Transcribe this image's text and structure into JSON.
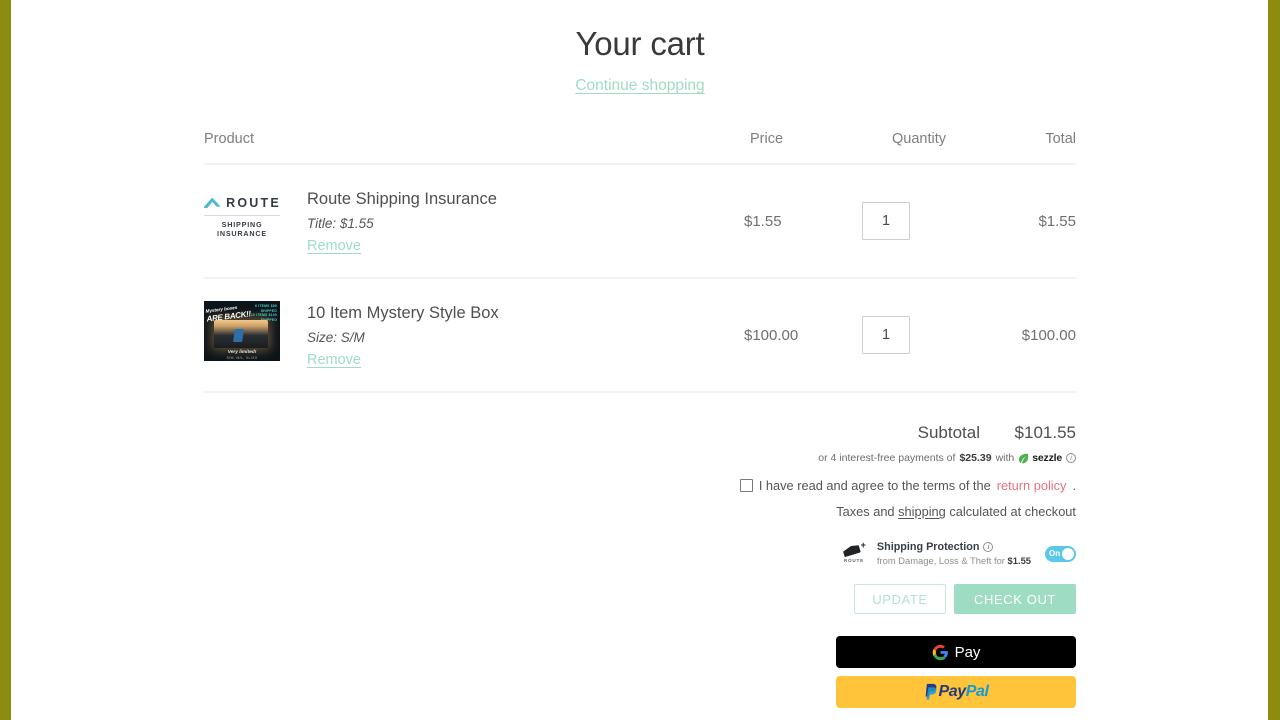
{
  "page": {
    "title": "Your cart",
    "continue_shopping": "Continue shopping"
  },
  "table": {
    "headers": {
      "product": "Product",
      "price": "Price",
      "quantity": "Quantity",
      "total": "Total"
    },
    "items": [
      {
        "title": "Route Shipping Insurance",
        "variant": "Title: $1.55",
        "remove_label": "Remove",
        "price": "$1.55",
        "quantity": "1",
        "total": "$1.55",
        "thumb_type": "route-logo",
        "thumb_text": {
          "word": "ROUTE",
          "sub": "SHIPPING INSURANCE"
        }
      },
      {
        "title": "10 Item Mystery Style Box",
        "variant": "Size: S/M",
        "remove_label": "Remove",
        "price": "$100.00",
        "quantity": "1",
        "total": "$100.00",
        "thumb_type": "mystery-box",
        "thumb_text": {
          "headline": "ARE BACK!!",
          "kicker": "Mystery boxes",
          "bullets": "6 ITEMS $69 / SHIPPED / 10 ITEMS $100 / SHIPPED",
          "limited": "Very limited!",
          "sizes": "S/M, M/L, XL/XX"
        }
      }
    ]
  },
  "summary": {
    "subtotal_label": "Subtotal",
    "subtotal_value": "$101.55",
    "sezzle": {
      "prefix": "or 4 interest-free payments of",
      "amount": "$25.39",
      "with": "with",
      "brand": "sezzle",
      "info_icon": "info-icon"
    },
    "terms": {
      "checkbox_checked": false,
      "text": "I have read and agree to the terms of the",
      "link": "return policy",
      "period": "."
    },
    "taxes": {
      "prefix": "Taxes and",
      "link": "shipping",
      "suffix": "calculated at checkout"
    }
  },
  "route_protection": {
    "brand": "ROUTE",
    "title": "Shipping Protection",
    "info_icon": "info-icon",
    "subtitle_prefix": "from Damage, Loss & Theft for",
    "price": "$1.55",
    "toggle_label": "On",
    "toggle_on": true
  },
  "actions": {
    "update": "UPDATE",
    "checkout": "CHECK OUT"
  },
  "payments": [
    {
      "name": "google-pay",
      "label": "Pay",
      "bg": "#000000"
    },
    {
      "name": "paypal",
      "label_1": "Pay",
      "label_2": "Pal",
      "bg": "#ffc43a"
    }
  ],
  "colors": {
    "accent_mint": "#9fdcc4",
    "edge_bar": "#8c8c10",
    "link_pink": "#e2737f",
    "toggle_blue": "#5bc8e8"
  }
}
